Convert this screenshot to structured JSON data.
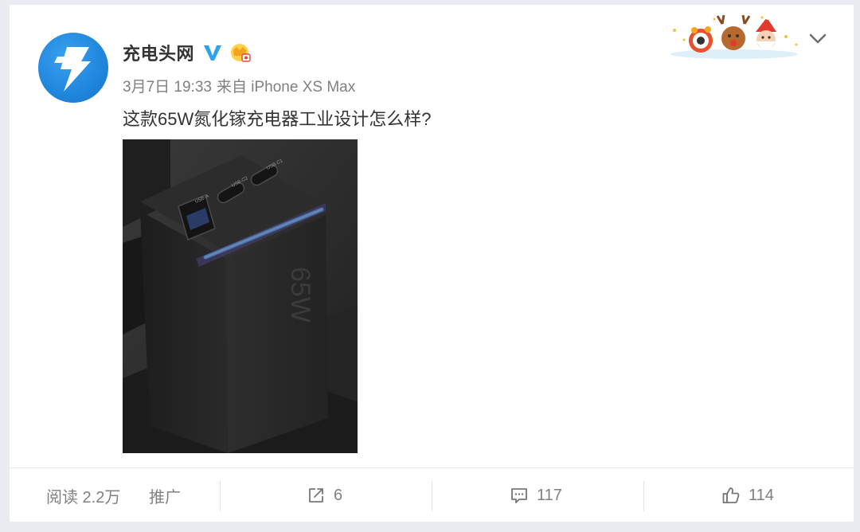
{
  "post": {
    "author_name": "充电头网",
    "date": "3月7日 19:33",
    "source": "来自 iPhone XS Max",
    "text": "这款65W氮化镓充电器工业设计怎么样?"
  },
  "photo": {
    "port_labels": [
      "USB-A",
      "USB-C2",
      "USB-C1"
    ],
    "product_mark": "65W"
  },
  "footer": {
    "reads_label": "阅读 2.2万",
    "promote_label": "推广",
    "repost_count": "6",
    "comment_count": "117",
    "like_count": "114"
  },
  "colors": {
    "avatar_blue": "#1f86dd",
    "verified_blue": "#2aa3f0",
    "muted_text": "#808080",
    "led_cyan": "#3fd0ff"
  },
  "icons": [
    "bolt-icon",
    "verified-v-icon",
    "crown-icon",
    "chevron-down-icon",
    "repost-icon",
    "comment-icon",
    "like-icon"
  ]
}
